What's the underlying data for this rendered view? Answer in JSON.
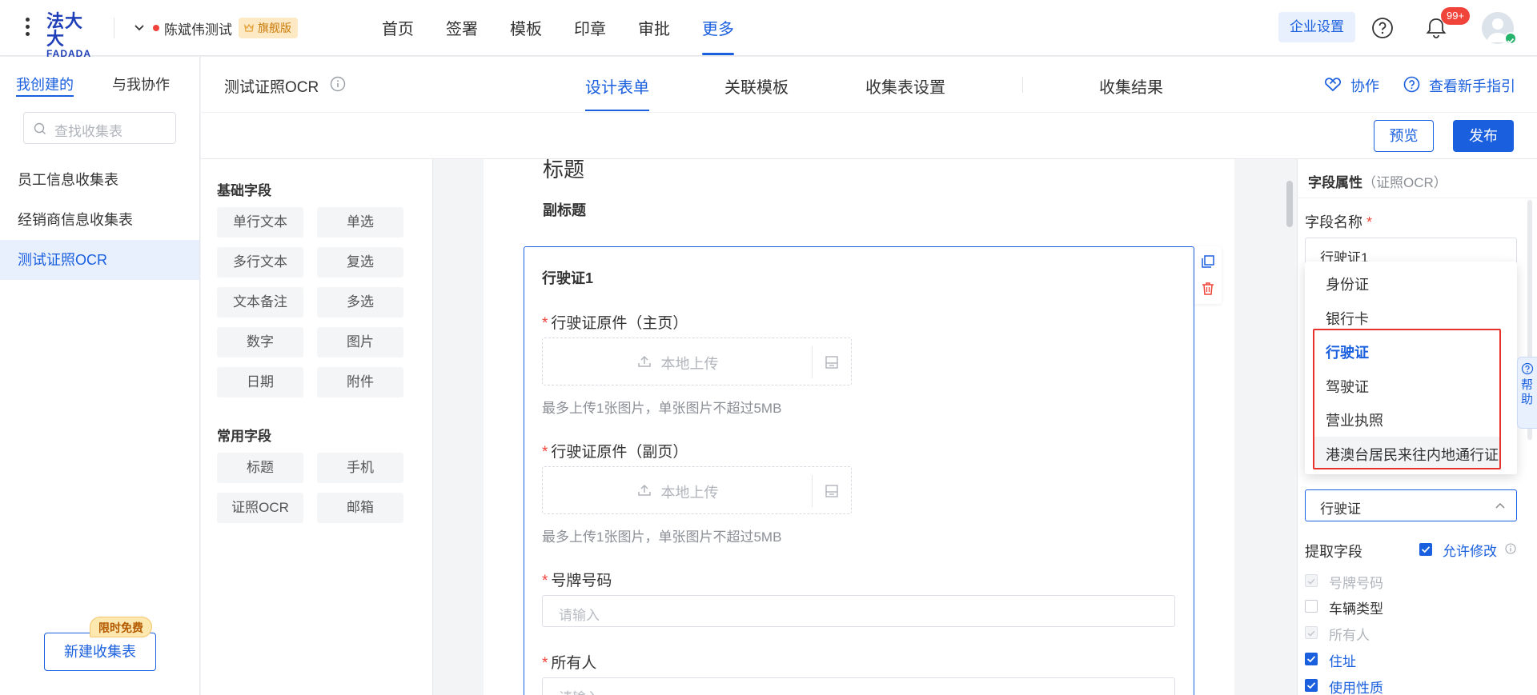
{
  "topbar": {
    "logo_top": "法大大",
    "logo_bottom": "FADADA",
    "org_name": "陈斌伟测试",
    "edition_badge": "旗舰版",
    "nav": [
      "首页",
      "签署",
      "模板",
      "印章",
      "审批",
      "更多"
    ],
    "active_nav": "更多",
    "enterprise_settings": "企业设置",
    "notification_count": "99+",
    "icons": [
      "kebab-menu-icon",
      "chevron-down-icon",
      "help-icon",
      "bell-icon",
      "avatar",
      "verified-icon"
    ]
  },
  "sidebar": {
    "tabs": [
      "我创建的",
      "与我协作"
    ],
    "active_tab": "我创建的",
    "search_placeholder": "查找收集表",
    "items": [
      "员工信息收集表",
      "经销商信息收集表",
      "测试证照OCR"
    ],
    "active_item": "测试证照OCR",
    "new_button": "新建收集表",
    "free_tag": "限时免费"
  },
  "subheader": {
    "form_title": "测试证照OCR",
    "tabs": [
      "设计表单",
      "关联模板",
      "收集表设置",
      "收集结果"
    ],
    "active_tab": "设计表单",
    "collaborate": "协作",
    "guide": "查看新手指引",
    "preview": "预览",
    "publish": "发布"
  },
  "palette": {
    "basic_heading": "基础字段",
    "basic_fields": [
      "单行文本",
      "单选",
      "多行文本",
      "复选",
      "文本备注",
      "多选",
      "数字",
      "图片",
      "日期",
      "附件"
    ],
    "common_heading": "常用字段",
    "common_fields": [
      "标题",
      "手机",
      "证照OCR",
      "邮箱"
    ]
  },
  "canvas": {
    "title": "标题",
    "subtitle": "副标题",
    "group_title": "行驶证1",
    "fields": [
      {
        "label": "行驶证原件（主页）",
        "upload_text": "本地上传",
        "hint": "最多上传1张图片，单张图片不超过5MB"
      },
      {
        "label": "行驶证原件（副页）",
        "upload_text": "本地上传",
        "hint": "最多上传1张图片，单张图片不超过5MB"
      },
      {
        "label": "号牌号码",
        "placeholder": "请输入"
      },
      {
        "label": "所有人",
        "placeholder": "请输入"
      }
    ]
  },
  "props": {
    "heading": "字段属性",
    "heading_sub": "（证照OCR）",
    "field_name_label": "字段名称",
    "field_name_value": "行驶证1",
    "dropdown_options": [
      "身份证",
      "银行卡",
      "行驶证",
      "驾驶证",
      "营业执照",
      "港澳台居民来往内地通行证"
    ],
    "selected_option": "行驶证",
    "select_value": "行驶证",
    "extract_label": "提取字段",
    "allow_edit": "允许修改",
    "extract_fields": [
      {
        "label": "号牌号码",
        "state": "disabled"
      },
      {
        "label": "车辆类型",
        "state": "unchecked"
      },
      {
        "label": "所有人",
        "state": "disabled"
      },
      {
        "label": "住址",
        "state": "checked"
      },
      {
        "label": "使用性质",
        "state": "checked"
      }
    ],
    "help_tab": "帮助"
  },
  "colors": {
    "primary": "#1a5fde",
    "danger": "#f0443a",
    "badge_gold": "#c97a08",
    "highlight_frame": "#e8322c"
  }
}
